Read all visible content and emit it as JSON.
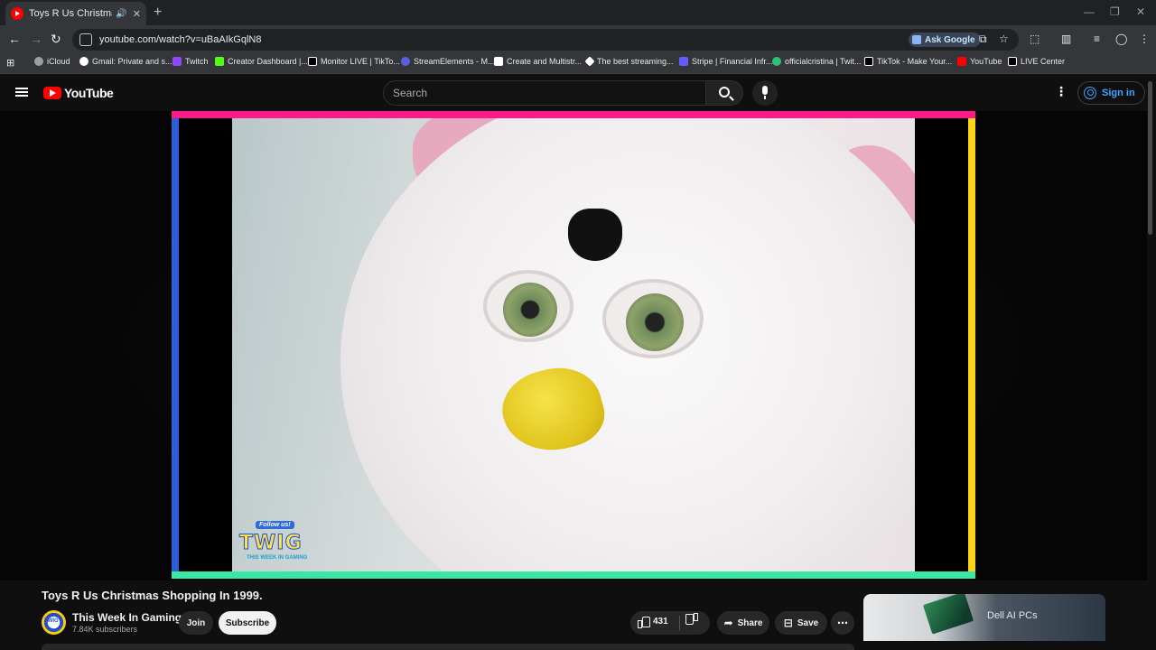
{
  "browser": {
    "tab_title": "Toys R Us Christmas Shopp",
    "url": "youtube.com/watch?v=uBaAIkGqlN8",
    "ask_google": "Ask Google",
    "bookmarks": [
      {
        "label": "iCloud",
        "color": "#9aa0a6"
      },
      {
        "label": "Gmail: Private and s...",
        "color": "#ffffff"
      },
      {
        "label": "Twitch",
        "color": "#9146ff"
      },
      {
        "label": "Creator Dashboard |...",
        "color": "#53fc18"
      },
      {
        "label": "Monitor LIVE | TikTo...",
        "color": "#ffffff"
      },
      {
        "label": "StreamElements - M...",
        "color": "#5a5fe0"
      },
      {
        "label": "Create and Multistr...",
        "color": "#ffffff"
      },
      {
        "label": "The best streaming...",
        "color": "#ffffff"
      },
      {
        "label": "Stripe | Financial Infr...",
        "color": "#635bff"
      },
      {
        "label": "officialcristina | Twit...",
        "color": "#2fbf71"
      },
      {
        "label": "TikTok - Make Your...",
        "color": "#ffffff"
      },
      {
        "label": "YouTube",
        "color": "#ff0000"
      },
      {
        "label": "LIVE Center",
        "color": "#ffffff"
      }
    ]
  },
  "youtube": {
    "logo_text": "YouTube",
    "search_placeholder": "Search",
    "sign_in": "Sign in"
  },
  "video": {
    "title": "Toys R Us Christmas Shopping In 1999.",
    "overlay_follow": "Follow us!",
    "overlay_logo": "TWIG",
    "overlay_sub": "THIS WEEK IN GAMING"
  },
  "channel": {
    "name": "This Week In Gaming",
    "subscribers": "7.84K subscribers",
    "avatar_text": "TWIG",
    "join": "Join",
    "subscribe": "Subscribe"
  },
  "actions": {
    "likes": "431",
    "share": "Share",
    "save": "Save"
  },
  "ad": {
    "label": "Dell AI PCs"
  }
}
